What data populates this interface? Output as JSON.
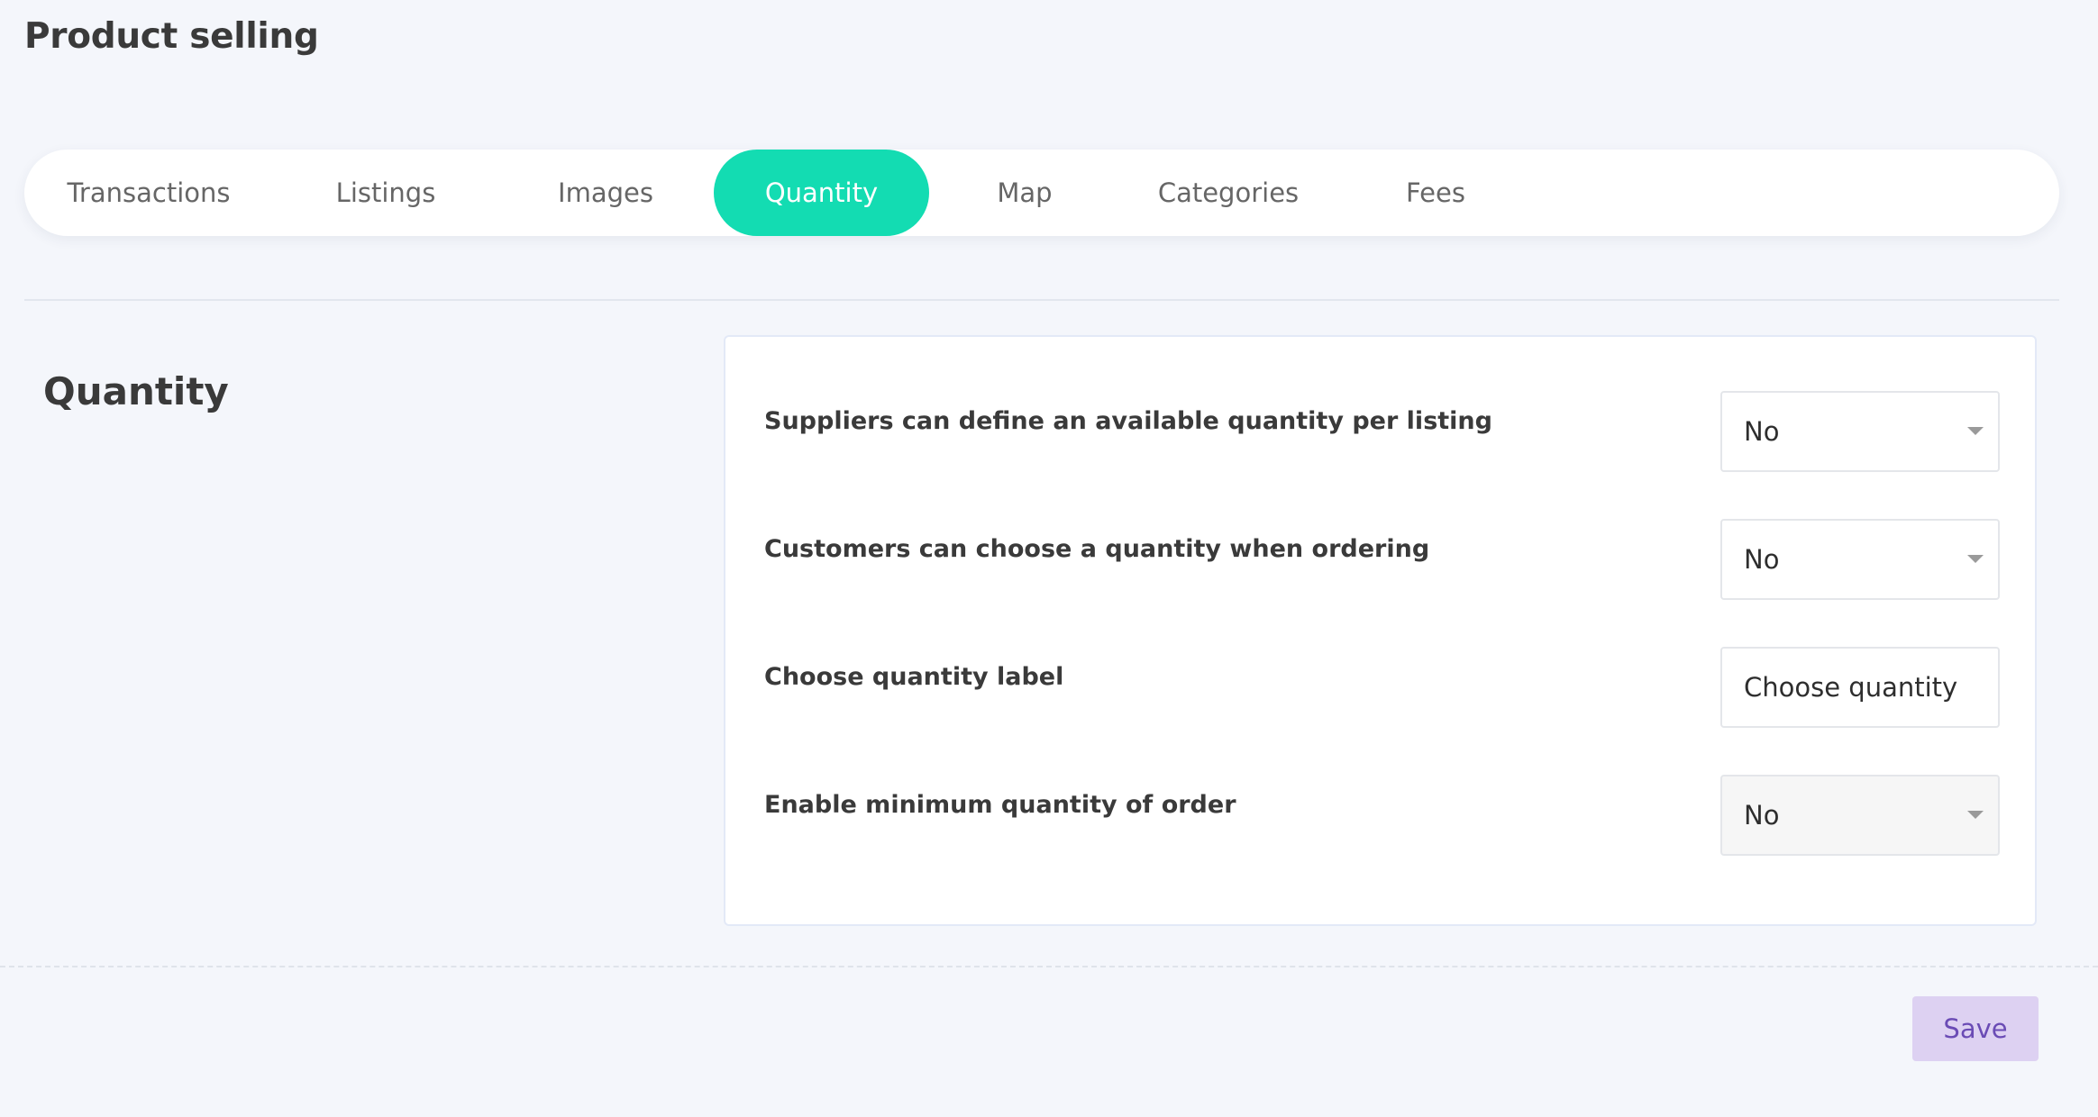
{
  "page": {
    "title": "Product selling"
  },
  "tabs": [
    {
      "label": "Transactions",
      "active": false
    },
    {
      "label": "Listings",
      "active": false
    },
    {
      "label": "Images",
      "active": false
    },
    {
      "label": "Quantity",
      "active": true
    },
    {
      "label": "Map",
      "active": false
    },
    {
      "label": "Categories",
      "active": false
    },
    {
      "label": "Fees",
      "active": false
    }
  ],
  "section": {
    "title": "Quantity"
  },
  "settings": [
    {
      "label": "Suppliers can define an available quantity per listing",
      "control": "select",
      "value": "No"
    },
    {
      "label": "Customers can choose a quantity when ordering",
      "control": "select",
      "value": "No"
    },
    {
      "label": "Choose quantity label",
      "control": "text",
      "value": "Choose quantity"
    },
    {
      "label": "Enable minimum quantity of order",
      "control": "select",
      "value": "No",
      "disabled": true
    }
  ],
  "footer": {
    "save_label": "Save"
  },
  "colors": {
    "accent": "#13dcb2",
    "save_bg": "#ddd1f2",
    "save_text": "#6a4bb5",
    "page_bg": "#f4f6fb"
  }
}
